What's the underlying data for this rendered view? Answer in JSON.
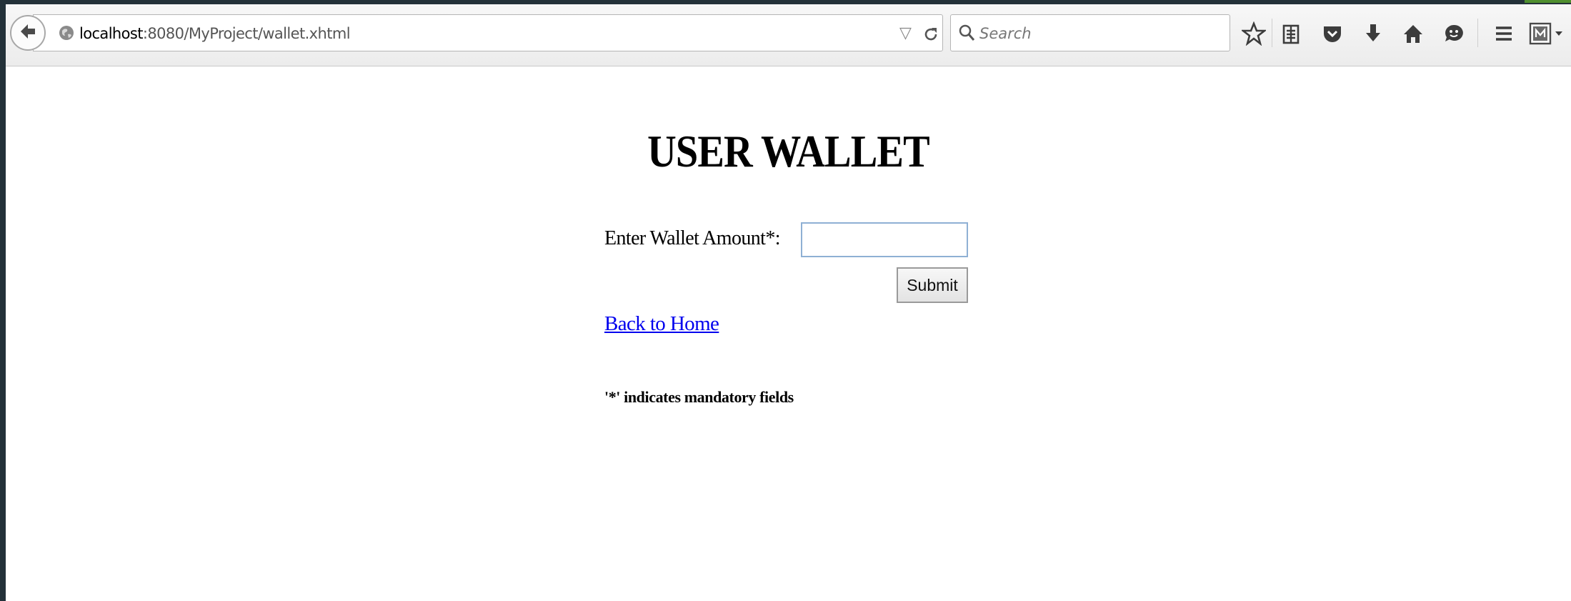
{
  "browser": {
    "url_host": "localhost",
    "url_rest": ":8080/MyProject/wallet.xhtml",
    "search_placeholder": "Search",
    "toolbar_icons": [
      "bookmark-star-icon",
      "reading-list-icon",
      "pocket-icon",
      "download-icon",
      "home-icon",
      "hello-icon",
      "menu-icon",
      "extension-icon"
    ]
  },
  "page": {
    "title": "USER WALLET",
    "form": {
      "amount_label": "Enter Wallet Amount*:",
      "amount_value": "",
      "submit_label": "Submit"
    },
    "back_link": "Back to Home",
    "mandatory_note": "'*' indicates mandatory fields"
  },
  "colors": {
    "link": "#0000ee",
    "window_frame": "#233139",
    "input_border": "#8fb0d4"
  }
}
